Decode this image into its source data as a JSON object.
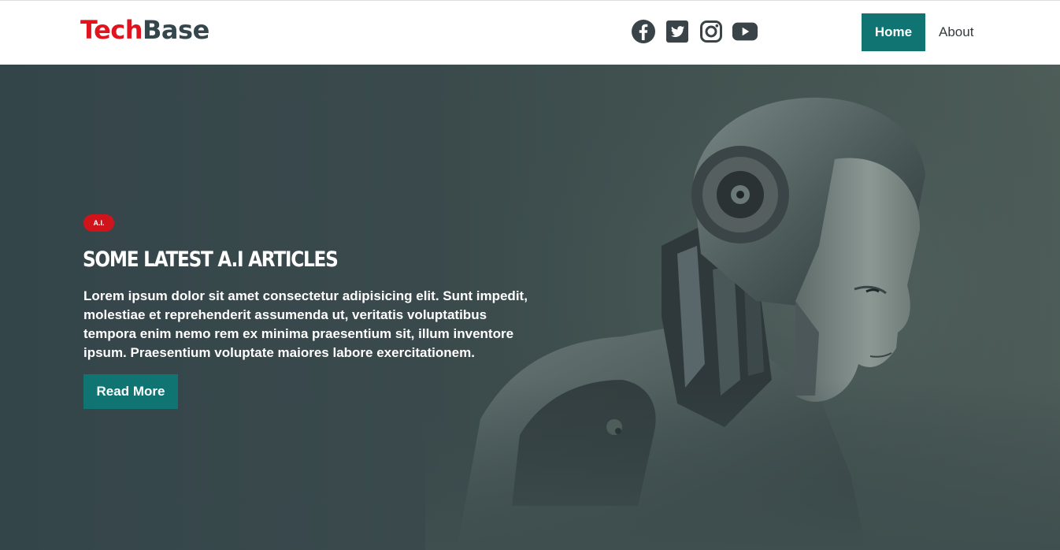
{
  "brand": {
    "part1": "Tech",
    "part2": "Base",
    "part1_color": "#e0141e",
    "part2_color": "#35474c"
  },
  "social": [
    {
      "name": "facebook-icon"
    },
    {
      "name": "twitter-icon"
    },
    {
      "name": "instagram-icon"
    },
    {
      "name": "youtube-icon"
    }
  ],
  "nav": {
    "items": [
      "Home",
      "About"
    ],
    "active": "Home"
  },
  "hero": {
    "badge": "A.I.",
    "title": "Some Latest A.I Articles",
    "text": "Lorem ipsum dolor sit amet consectetur adipisicing elit. Sunt impedit, molestiae et reprehenderit assumenda ut, veritatis voluptatibus tempora enim nemo rem ex minima praesentium sit, illum inventore ipsum. Praesentium voluptate maiores labore exercitationem.",
    "button": "Read More"
  },
  "colors": {
    "accent": "#0f7472",
    "badge": "#d0141c",
    "hero_bg": "#3a4a4c"
  }
}
